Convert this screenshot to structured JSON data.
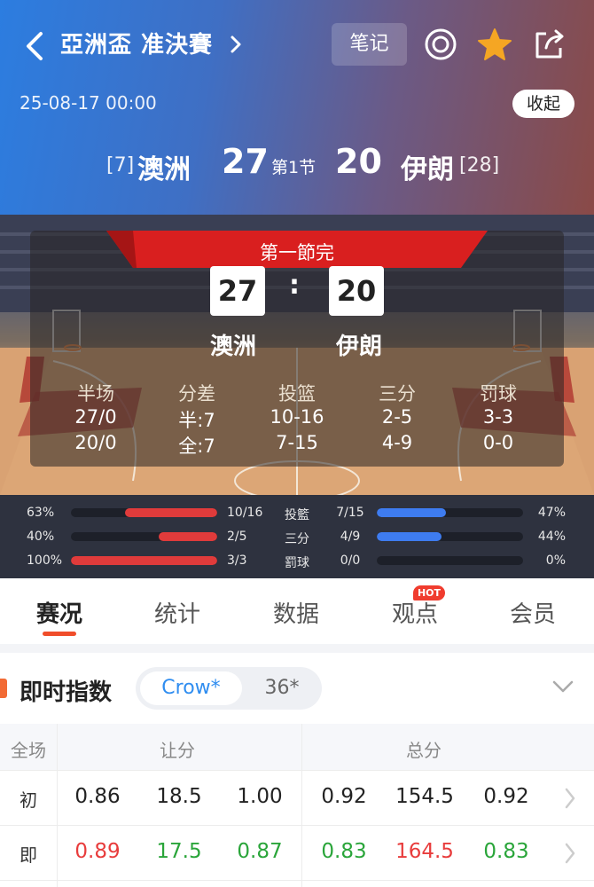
{
  "header": {
    "title": "亞洲盃 准決賽",
    "note_label": "笔记",
    "match_time": "25-08-17 00:00",
    "collapse_label": "收起",
    "home_rank": "[7]",
    "home_team": "澳洲",
    "home_score": "27",
    "period": "第1节",
    "away_score": "20",
    "away_team": "伊朗",
    "away_rank": "[28]"
  },
  "scoreboard": {
    "status": "第一節完",
    "home_score": "27",
    "away_score": "20",
    "colon": ":",
    "home_team": "澳洲",
    "away_team": "伊朗",
    "columns": [
      {
        "header": "半场",
        "home": "27/0",
        "away": "20/0"
      },
      {
        "header": "分差",
        "home": "半:7",
        "away": "全:7"
      },
      {
        "header": "投篮",
        "home": "10-16",
        "away": "7-15"
      },
      {
        "header": "三分",
        "home": "2-5",
        "away": "4-9"
      },
      {
        "header": "罚球",
        "home": "3-3",
        "away": "0-0"
      }
    ]
  },
  "compare": [
    {
      "label": "投籃",
      "home_pct": "63%",
      "home_frac": "10/16",
      "home_ratio": 0.63,
      "away_frac": "7/15",
      "away_pct": "47%",
      "away_ratio": 0.47
    },
    {
      "label": "三分",
      "home_pct": "40%",
      "home_frac": "2/5",
      "home_ratio": 0.4,
      "away_frac": "4/9",
      "away_pct": "44%",
      "away_ratio": 0.44
    },
    {
      "label": "罰球",
      "home_pct": "100%",
      "home_frac": "3/3",
      "home_ratio": 1.0,
      "away_frac": "0/0",
      "away_pct": "0%",
      "away_ratio": 0.0
    }
  ],
  "tabs": [
    {
      "label": "赛况",
      "active": true
    },
    {
      "label": "统计",
      "active": false
    },
    {
      "label": "数据",
      "active": false
    },
    {
      "label": "观点",
      "active": false,
      "badge": "HOT"
    },
    {
      "label": "会员",
      "active": false
    }
  ],
  "odds": {
    "title": "即时指数",
    "source_selected": "Crow*",
    "source_other": "36*",
    "headers": {
      "scope": "全场",
      "handicap": "让分",
      "total": "总分"
    },
    "rows": [
      {
        "label": "初",
        "values": [
          "0.86",
          "18.5",
          "1.00",
          "0.92",
          "154.5",
          "0.92"
        ],
        "colors": [
          "",
          "",
          "",
          "",
          "",
          ""
        ]
      },
      {
        "label": "即",
        "values": [
          "0.89",
          "17.5",
          "0.87",
          "0.83",
          "164.5",
          "0.83"
        ],
        "colors": [
          "red",
          "green",
          "green",
          "green",
          "red",
          "green"
        ]
      }
    ]
  },
  "colors": {
    "accent": "#f04d2a",
    "home_bar": "#e03b3b",
    "away_bar": "#3e7cf0",
    "star": "#f5a623",
    "link": "#2f8df0"
  }
}
